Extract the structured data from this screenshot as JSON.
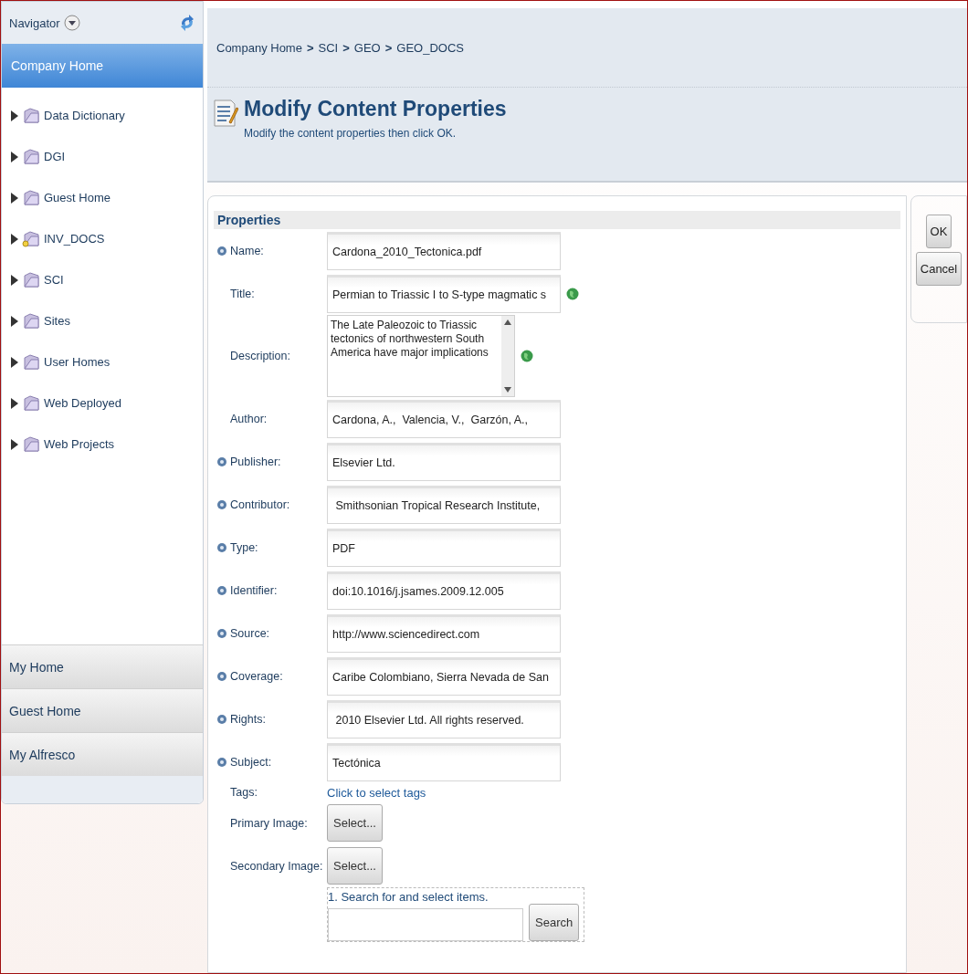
{
  "navigator": {
    "title": "Navigator"
  },
  "sidebar": {
    "items": [
      {
        "label": "Company Home",
        "selected": true
      }
    ],
    "tree": [
      {
        "label": "Data Dictionary",
        "kind": "folder"
      },
      {
        "label": "DGI",
        "kind": "folder"
      },
      {
        "label": "Guest Home",
        "kind": "folder"
      },
      {
        "label": "INV_DOCS",
        "kind": "rule-folder"
      },
      {
        "label": "SCI",
        "kind": "folder"
      },
      {
        "label": "Sites",
        "kind": "folder"
      },
      {
        "label": "User Homes",
        "kind": "folder"
      },
      {
        "label": "Web Deployed",
        "kind": "folder"
      },
      {
        "label": "Web Projects",
        "kind": "folder"
      }
    ],
    "bottom_items": [
      {
        "label": "My Home",
        "selected": false
      },
      {
        "label": "Guest Home",
        "selected": false
      },
      {
        "label": "My Alfresco",
        "selected": false
      }
    ]
  },
  "breadcrumb": [
    {
      "label": "Company Home"
    },
    {
      "label": "SCI"
    },
    {
      "label": "GEO"
    },
    {
      "label": "GEO_DOCS"
    }
  ],
  "breadcrumb_separator": ">",
  "page": {
    "title": "Modify Content Properties",
    "subtitle": "Modify the content properties then click OK."
  },
  "properties": {
    "title": "Properties",
    "fields": [
      {
        "label": "Name:",
        "required": true,
        "kind": "text",
        "value": "Cardona_2010_Tectonica.pdf",
        "multilingual": false
      },
      {
        "label": "Title:",
        "required": false,
        "kind": "text",
        "value": "Permian to Triassic I to S-type magmatic s",
        "multilingual": true
      },
      {
        "label": "Description:",
        "required": false,
        "kind": "textarea",
        "value": "The Late Paleozoic to Triassic tectonics of northwestern South America have major implications",
        "multilingual": true
      },
      {
        "label": "Author:",
        "required": false,
        "kind": "text",
        "value": "Cardona, A.,  Valencia, V.,  Garzón, A.,",
        "multilingual": false
      },
      {
        "label": "Publisher:",
        "required": true,
        "kind": "text",
        "value": "Elsevier Ltd.",
        "multilingual": false
      },
      {
        "label": "Contributor:",
        "required": true,
        "kind": "text",
        "value": " Smithsonian Tropical Research Institute,",
        "multilingual": false
      },
      {
        "label": "Type:",
        "required": true,
        "kind": "text",
        "value": "PDF",
        "multilingual": false
      },
      {
        "label": "Identifier:",
        "required": true,
        "kind": "text",
        "value": "doi:10.1016/j.jsames.2009.12.005",
        "multilingual": false
      },
      {
        "label": "Source:",
        "required": true,
        "kind": "text",
        "value": "http://www.sciencedirect.com",
        "multilingual": false
      },
      {
        "label": "Coverage:",
        "required": true,
        "kind": "text",
        "value": "Caribe Colombiano, Sierra Nevada de San",
        "multilingual": false
      },
      {
        "label": "Rights:",
        "required": true,
        "kind": "text",
        "value": " 2010 Elsevier Ltd. All rights reserved.",
        "multilingual": false
      },
      {
        "label": "Subject:",
        "required": true,
        "kind": "text",
        "value": "Tectónica",
        "multilingual": false
      },
      {
        "label": "Tags:",
        "required": false,
        "kind": "link",
        "value": "Click to select tags",
        "multilingual": false
      },
      {
        "label": "Primary Image:",
        "required": false,
        "kind": "button",
        "value": "Select...",
        "multilingual": false
      },
      {
        "label": "Secondary Image:",
        "required": false,
        "kind": "button",
        "value": "Select...",
        "multilingual": false
      }
    ],
    "search": {
      "instruction": "1. Search for and select items.",
      "button": "Search"
    }
  },
  "buttons": [
    {
      "label": "OK"
    },
    {
      "label": "Cancel"
    }
  ]
}
